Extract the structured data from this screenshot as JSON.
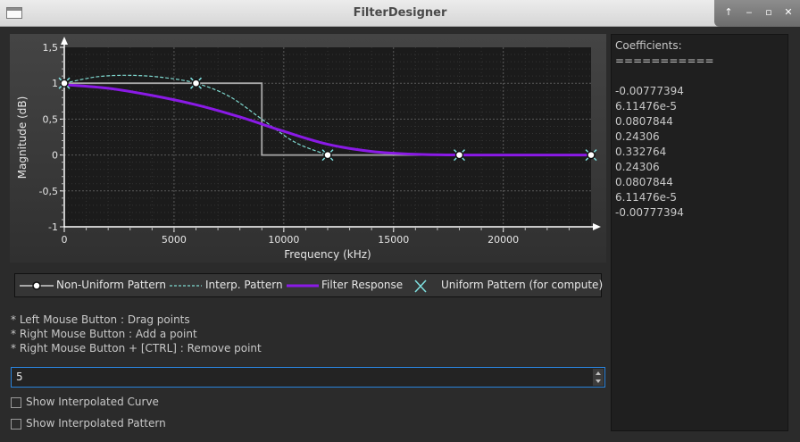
{
  "window": {
    "title": "FilterDesigner"
  },
  "plot": {
    "ylabel": "Magnitude (dB)",
    "xlabel": "Frequency (kHz)",
    "y_ticks": [
      "1,5",
      "1",
      "0,5",
      "0",
      "-0,5",
      "-1"
    ],
    "x_ticks": [
      "0",
      "5000",
      "10000",
      "15000",
      "20000"
    ]
  },
  "legend": {
    "non_uniform": "Non-Uniform Pattern",
    "interp": "Interp. Pattern",
    "response": "Filter Response",
    "uniform": "Uniform Pattern (for compute)"
  },
  "colors": {
    "response": "#8a1ae6",
    "interp": "#7fd9d0",
    "pattern": "#a8a8a8",
    "uniform": "#7fe0e0",
    "accent": "#2a82da"
  },
  "help": [
    "* Left Mouse Button  : Drag points",
    "* Right Mouse Button : Add a point",
    "* Right Mouse Button + [CTRL] : Remove point"
  ],
  "spinbox": {
    "value": "5"
  },
  "checkboxes": {
    "interp_curve": "Show Interpolated Curve",
    "interp_pattern": "Show Interpolated Pattern"
  },
  "coefficients": {
    "header": "Coefficients:",
    "separator": "===========",
    "values": [
      "-0.00777394",
      "6.11476e-5",
      "0.0807844",
      "0.24306",
      "0.332764",
      "0.24306",
      "0.0807844",
      "6.11476e-5",
      "-0.00777394"
    ]
  },
  "chart_data": {
    "type": "line",
    "xlabel": "Frequency (kHz)",
    "ylabel": "Magnitude (dB)",
    "xlim": [
      0,
      24000
    ],
    "ylim": [
      -1,
      1.5
    ],
    "grid": true,
    "series": [
      {
        "name": "Non-Uniform Pattern",
        "x": [
          0,
          6000,
          9000,
          9000,
          12000,
          18000,
          24000
        ],
        "y": [
          1,
          1,
          1,
          0,
          0,
          0,
          0
        ]
      },
      {
        "name": "Interp. Pattern",
        "x": [
          0,
          1500,
          3000,
          4500,
          6000,
          7500,
          9000,
          10500,
          12000
        ],
        "y": [
          1,
          1.09,
          1.11,
          1.08,
          1,
          0.82,
          0.5,
          0.18,
          0
        ]
      },
      {
        "name": "Filter Response",
        "x": [
          0,
          2000,
          4000,
          6000,
          8000,
          10000,
          12000,
          14000,
          16000,
          18000,
          20000,
          22000,
          24000
        ],
        "y": [
          0.98,
          0.93,
          0.83,
          0.7,
          0.53,
          0.33,
          0.15,
          0.05,
          0.01,
          0,
          0,
          0,
          0
        ]
      },
      {
        "name": "Uniform Pattern (for compute)",
        "x": [
          0,
          6000,
          12000,
          18000,
          24000
        ],
        "y": [
          1,
          1,
          0,
          0,
          0
        ]
      }
    ]
  }
}
